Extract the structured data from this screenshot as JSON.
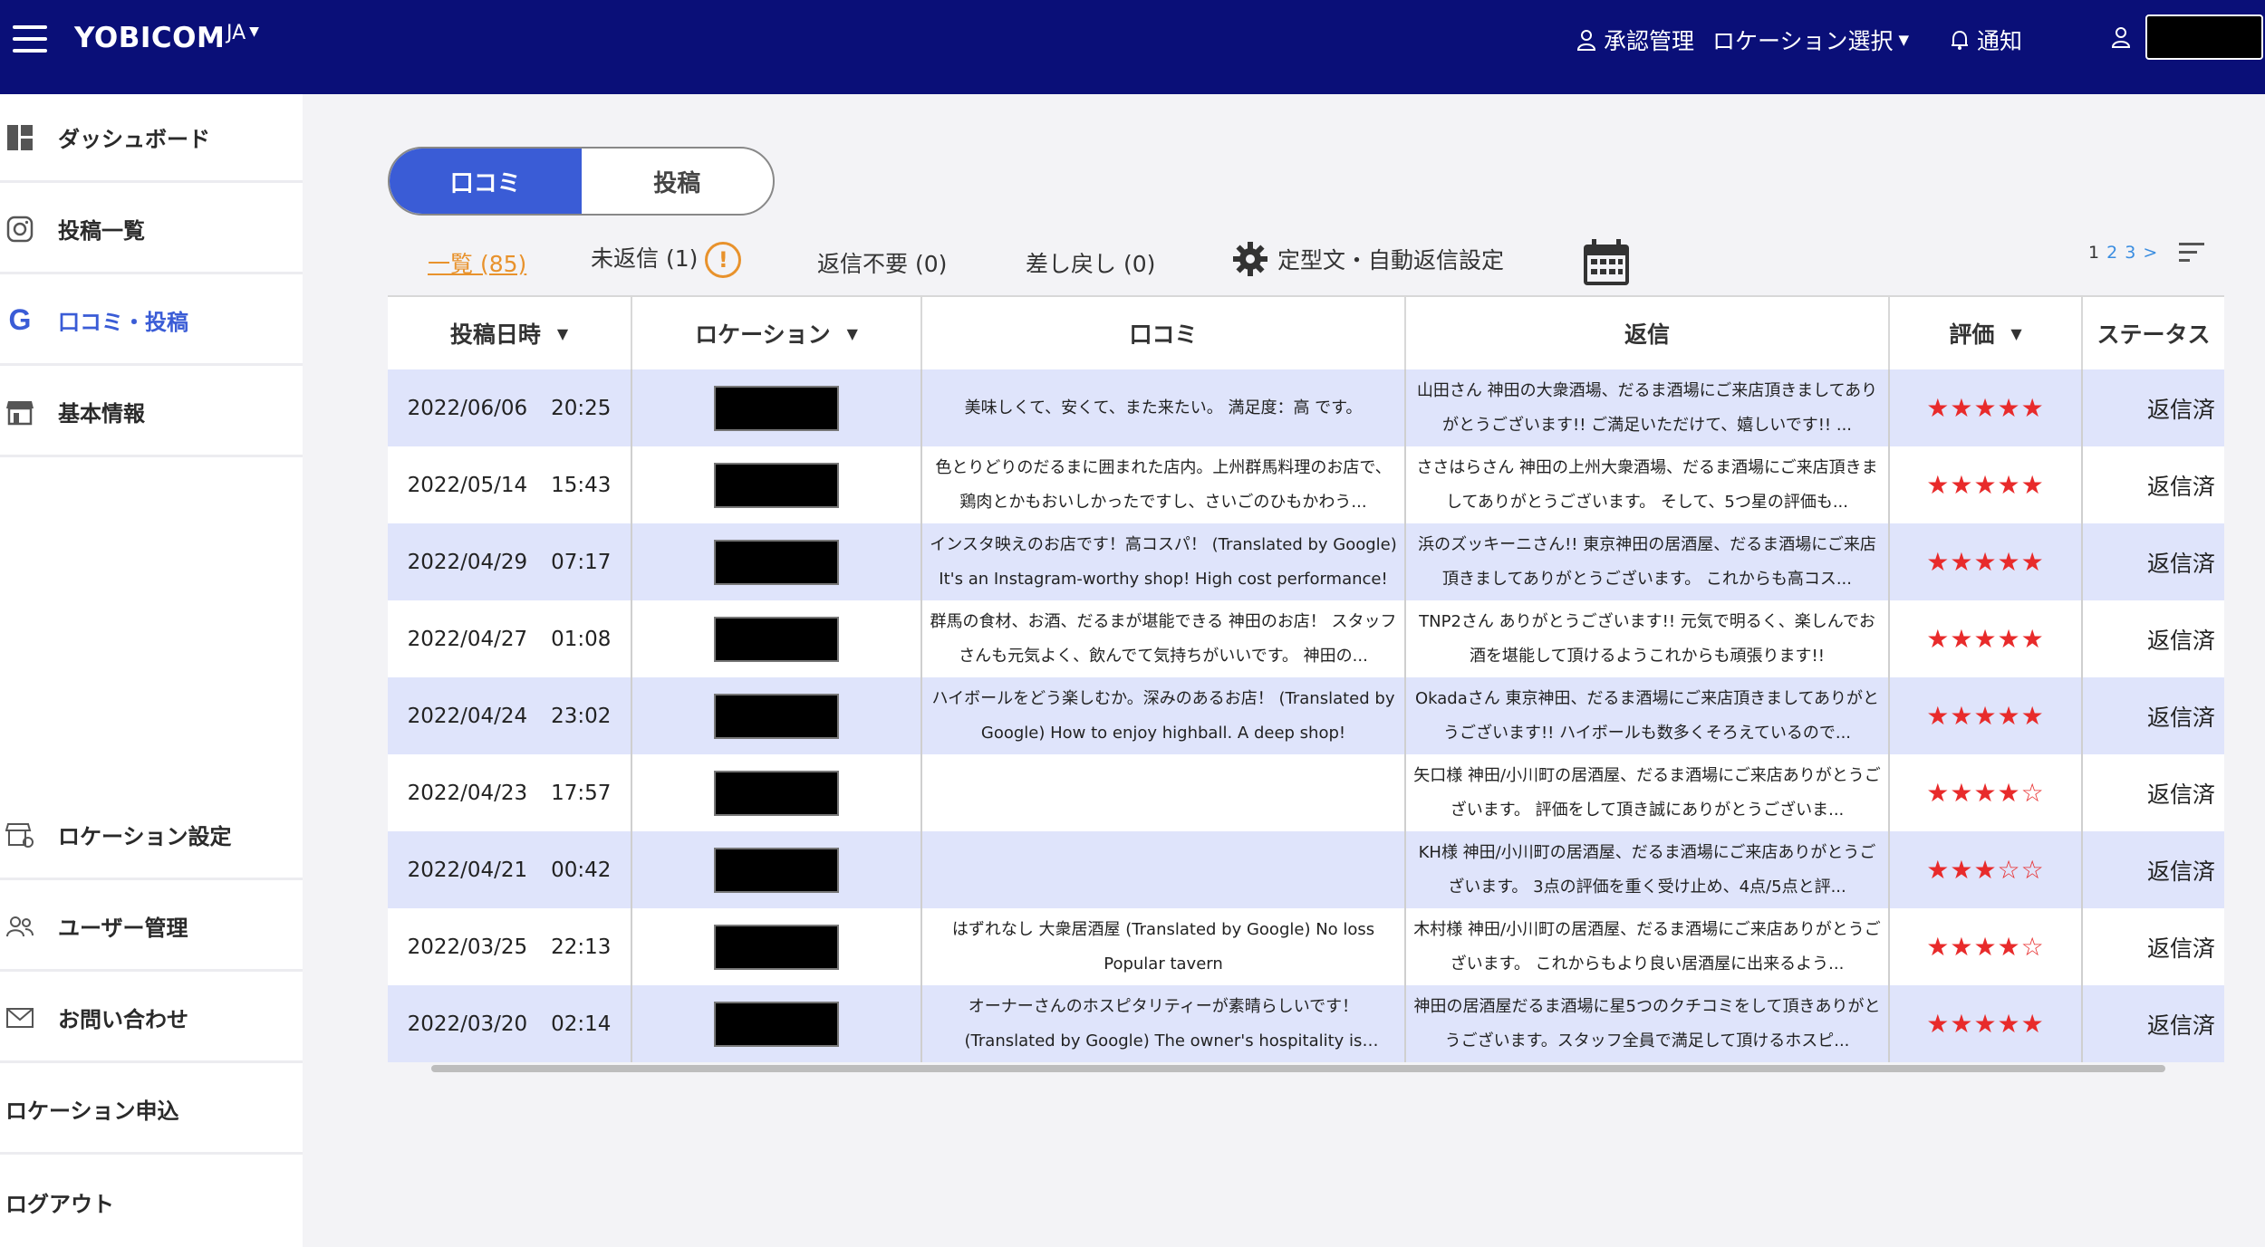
{
  "header": {
    "brand": "YOBICOM",
    "lang": "JA",
    "nav_approval": "承認管理",
    "nav_location": "ロケーション選択",
    "nav_notice": "通知"
  },
  "sidebar": {
    "items": [
      {
        "label": "ダッシュボード",
        "icon": "dashboard-icon"
      },
      {
        "label": "投稿一覧",
        "icon": "instagram-icon"
      },
      {
        "label": "口コミ・投稿",
        "icon": "google-icon"
      },
      {
        "label": "基本情報",
        "icon": "store-icon"
      },
      {
        "label": "ロケーション設定",
        "icon": "location-settings-icon"
      },
      {
        "label": "ユーザー管理",
        "icon": "users-icon"
      },
      {
        "label": "お問い合わせ",
        "icon": "mail-icon"
      },
      {
        "label": "ロケーション申込"
      },
      {
        "label": "ログアウト"
      }
    ]
  },
  "toggle": {
    "reviews": "口コミ",
    "posts": "投稿"
  },
  "filters": {
    "all": "一覧 (85)",
    "unreplied": "未返信 (1)",
    "no_reply": "返信不要 (0)",
    "returned": "差し戻し (0)",
    "settings": "定型文・自動返信設定"
  },
  "pager": {
    "p1": "1",
    "p2": "2",
    "p3": "3",
    "next": ">"
  },
  "table": {
    "headers": {
      "date": "投稿日時",
      "location": "ロケーション",
      "review": "口コミ",
      "reply": "返信",
      "rating": "評価",
      "status": "ステータス"
    },
    "rows": [
      {
        "date": "2022/06/06",
        "time": "20:25",
        "review": "美味しくて、安くて、また来たい。 満足度：高 です。",
        "reply": "山田さん 神田の大衆酒場、だるま酒場にご来店頂きましてありがとうございます!! ご満足いただけて、嬉しいです!! ...",
        "stars": "★★★★★",
        "rating": 5,
        "status": "返信済"
      },
      {
        "date": "2022/05/14",
        "time": "15:43",
        "review": "色とりどりのだるまに囲まれた店内。上州群馬料理のお店で、鶏肉とかもおいしかったですし、さいごのひもかわう...",
        "reply": "ささはらさん 神田の上州大衆酒場、だるま酒場にご来店頂きましてありがとうございます。 そして、5つ星の評価も...",
        "stars": "★★★★★",
        "rating": 5,
        "status": "返信済"
      },
      {
        "date": "2022/04/29",
        "time": "07:17",
        "review": "インスタ映えのお店です！高コスパ！ (Translated by Google) It's an Instagram-worthy shop! High cost performance!",
        "reply": "浜のズッキーニさん!! 東京神田の居酒屋、だるま酒場にご来店頂きましてありがとうございます。 これからも高コス...",
        "stars": "★★★★★",
        "rating": 5,
        "status": "返信済"
      },
      {
        "date": "2022/04/27",
        "time": "01:08",
        "review": "群馬の食材、お酒、だるまが堪能できる 神田のお店！ スタッフさんも元気よく、飲んでて気持ちがいいです。 神田の...",
        "reply": "TNP2さん ありがとうございます!! 元気で明るく、楽しんでお酒を堪能して頂けるようこれからも頑張ります!!",
        "stars": "★★★★★",
        "rating": 5,
        "status": "返信済"
      },
      {
        "date": "2022/04/24",
        "time": "23:02",
        "review": "ハイボールをどう楽しむか。深みのあるお店！ (Translated by Google) How to enjoy highball. A deep shop!",
        "reply": "Okadaさん 東京神田、だるま酒場にご来店頂きましてありがとうございます!! ハイボールも数多くそろえているので...",
        "stars": "★★★★★",
        "rating": 5,
        "status": "返信済"
      },
      {
        "date": "2022/04/23",
        "time": "17:57",
        "review": "",
        "reply": "矢口様 神田/小川町の居酒屋、だるま酒場にご来店ありがとうございます。 評価をして頂き誠にありがとうございま...",
        "stars": "★★★★☆",
        "rating": 4,
        "status": "返信済"
      },
      {
        "date": "2022/04/21",
        "time": "00:42",
        "review": "",
        "reply": "KH様 神田/小川町の居酒屋、だるま酒場にご来店ありがとうございます。 3点の評価を重く受け止め、4点/5点と評...",
        "stars": "★★★☆☆",
        "rating": 3,
        "status": "返信済"
      },
      {
        "date": "2022/03/25",
        "time": "22:13",
        "review": "はずれなし 大衆居酒屋 (Translated by Google) No loss Popular tavern",
        "reply": "木村様 神田/小川町の居酒屋、だるま酒場にご来店ありがとうございます。 これからもより良い居酒屋に出来るよう...",
        "stars": "★★★★☆",
        "rating": 4,
        "status": "返信済"
      },
      {
        "date": "2022/03/20",
        "time": "02:14",
        "review": "オーナーさんのホスピタリティーが素晴らしいです！ (Translated by Google) The owner's hospitality is amazing!",
        "reply": "神田の居酒屋だるま酒場に星5つのクチコミをして頂きありがとうございます。スタッフ全員で満足して頂けるホスピ...",
        "stars": "★★★★★",
        "rating": 5,
        "status": "返信済"
      }
    ]
  },
  "colors": {
    "header_bg": "#0a0f78",
    "accent": "#3a5cd6",
    "active_tab": "#e8922c",
    "star": "#e82b2b",
    "row_alt": "#dfe4fb"
  }
}
